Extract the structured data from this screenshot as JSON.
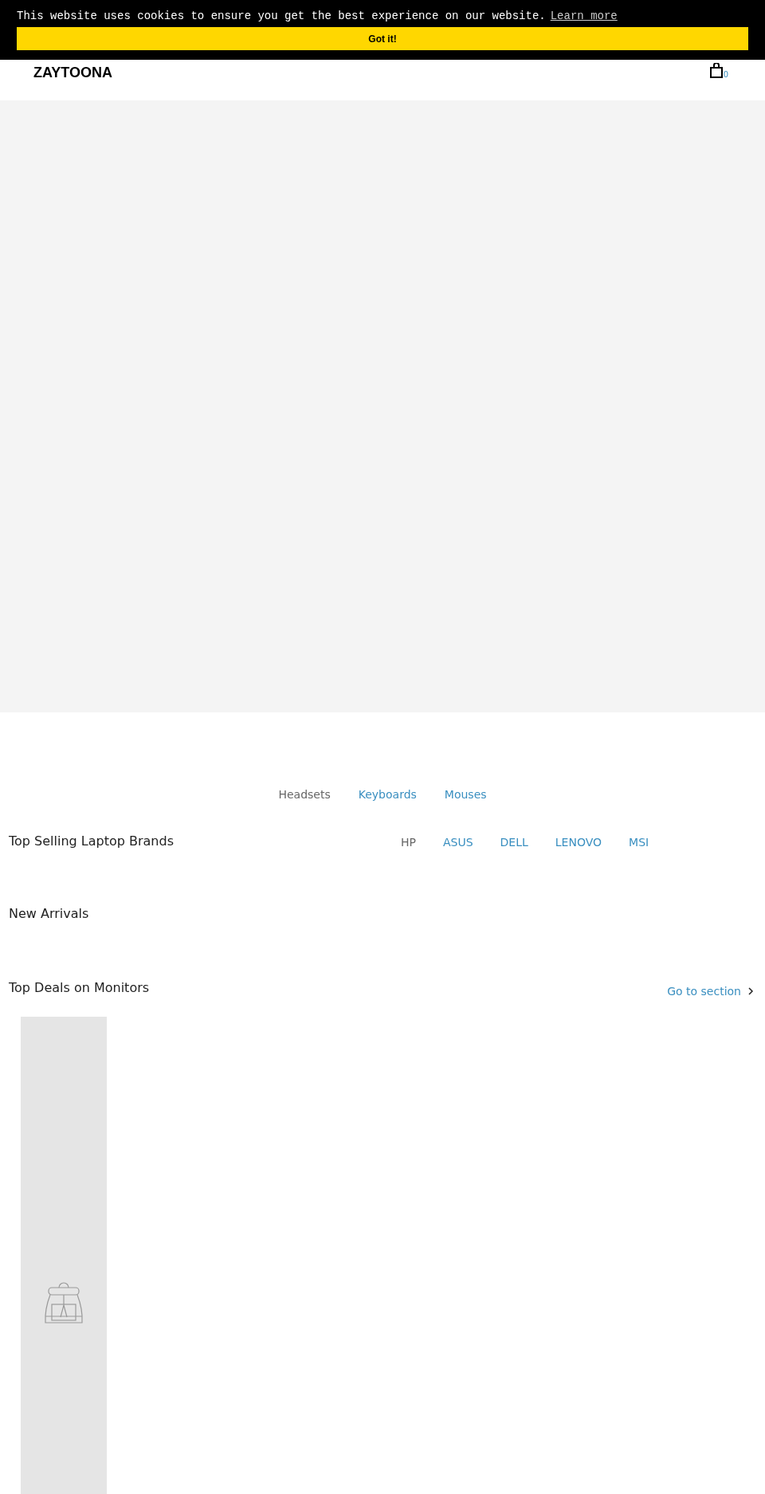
{
  "cookie_banner": {
    "message": "This website uses cookies to ensure you get the best experience on our website.",
    "link": "Learn more",
    "button": "Got it!"
  },
  "header": {
    "logo": "ZAYTOONA",
    "cart_count": "0"
  },
  "category_tabs": [
    {
      "label": "Headsets",
      "selected": true
    },
    {
      "label": "Keyboards",
      "selected": false
    },
    {
      "label": "Mouses",
      "selected": false
    }
  ],
  "brands": {
    "title": "Top Selling Laptop Brands",
    "tabs": [
      {
        "label": "HP",
        "selected": true
      },
      {
        "label": "ASUS",
        "selected": false
      },
      {
        "label": "DELL",
        "selected": false
      },
      {
        "label": "LENOVO",
        "selected": false
      },
      {
        "label": "MSI",
        "selected": false
      }
    ]
  },
  "new_arrivals": {
    "title": "New Arrivals"
  },
  "monitors": {
    "title": "Top Deals on Monitors",
    "link": "Go to section"
  }
}
